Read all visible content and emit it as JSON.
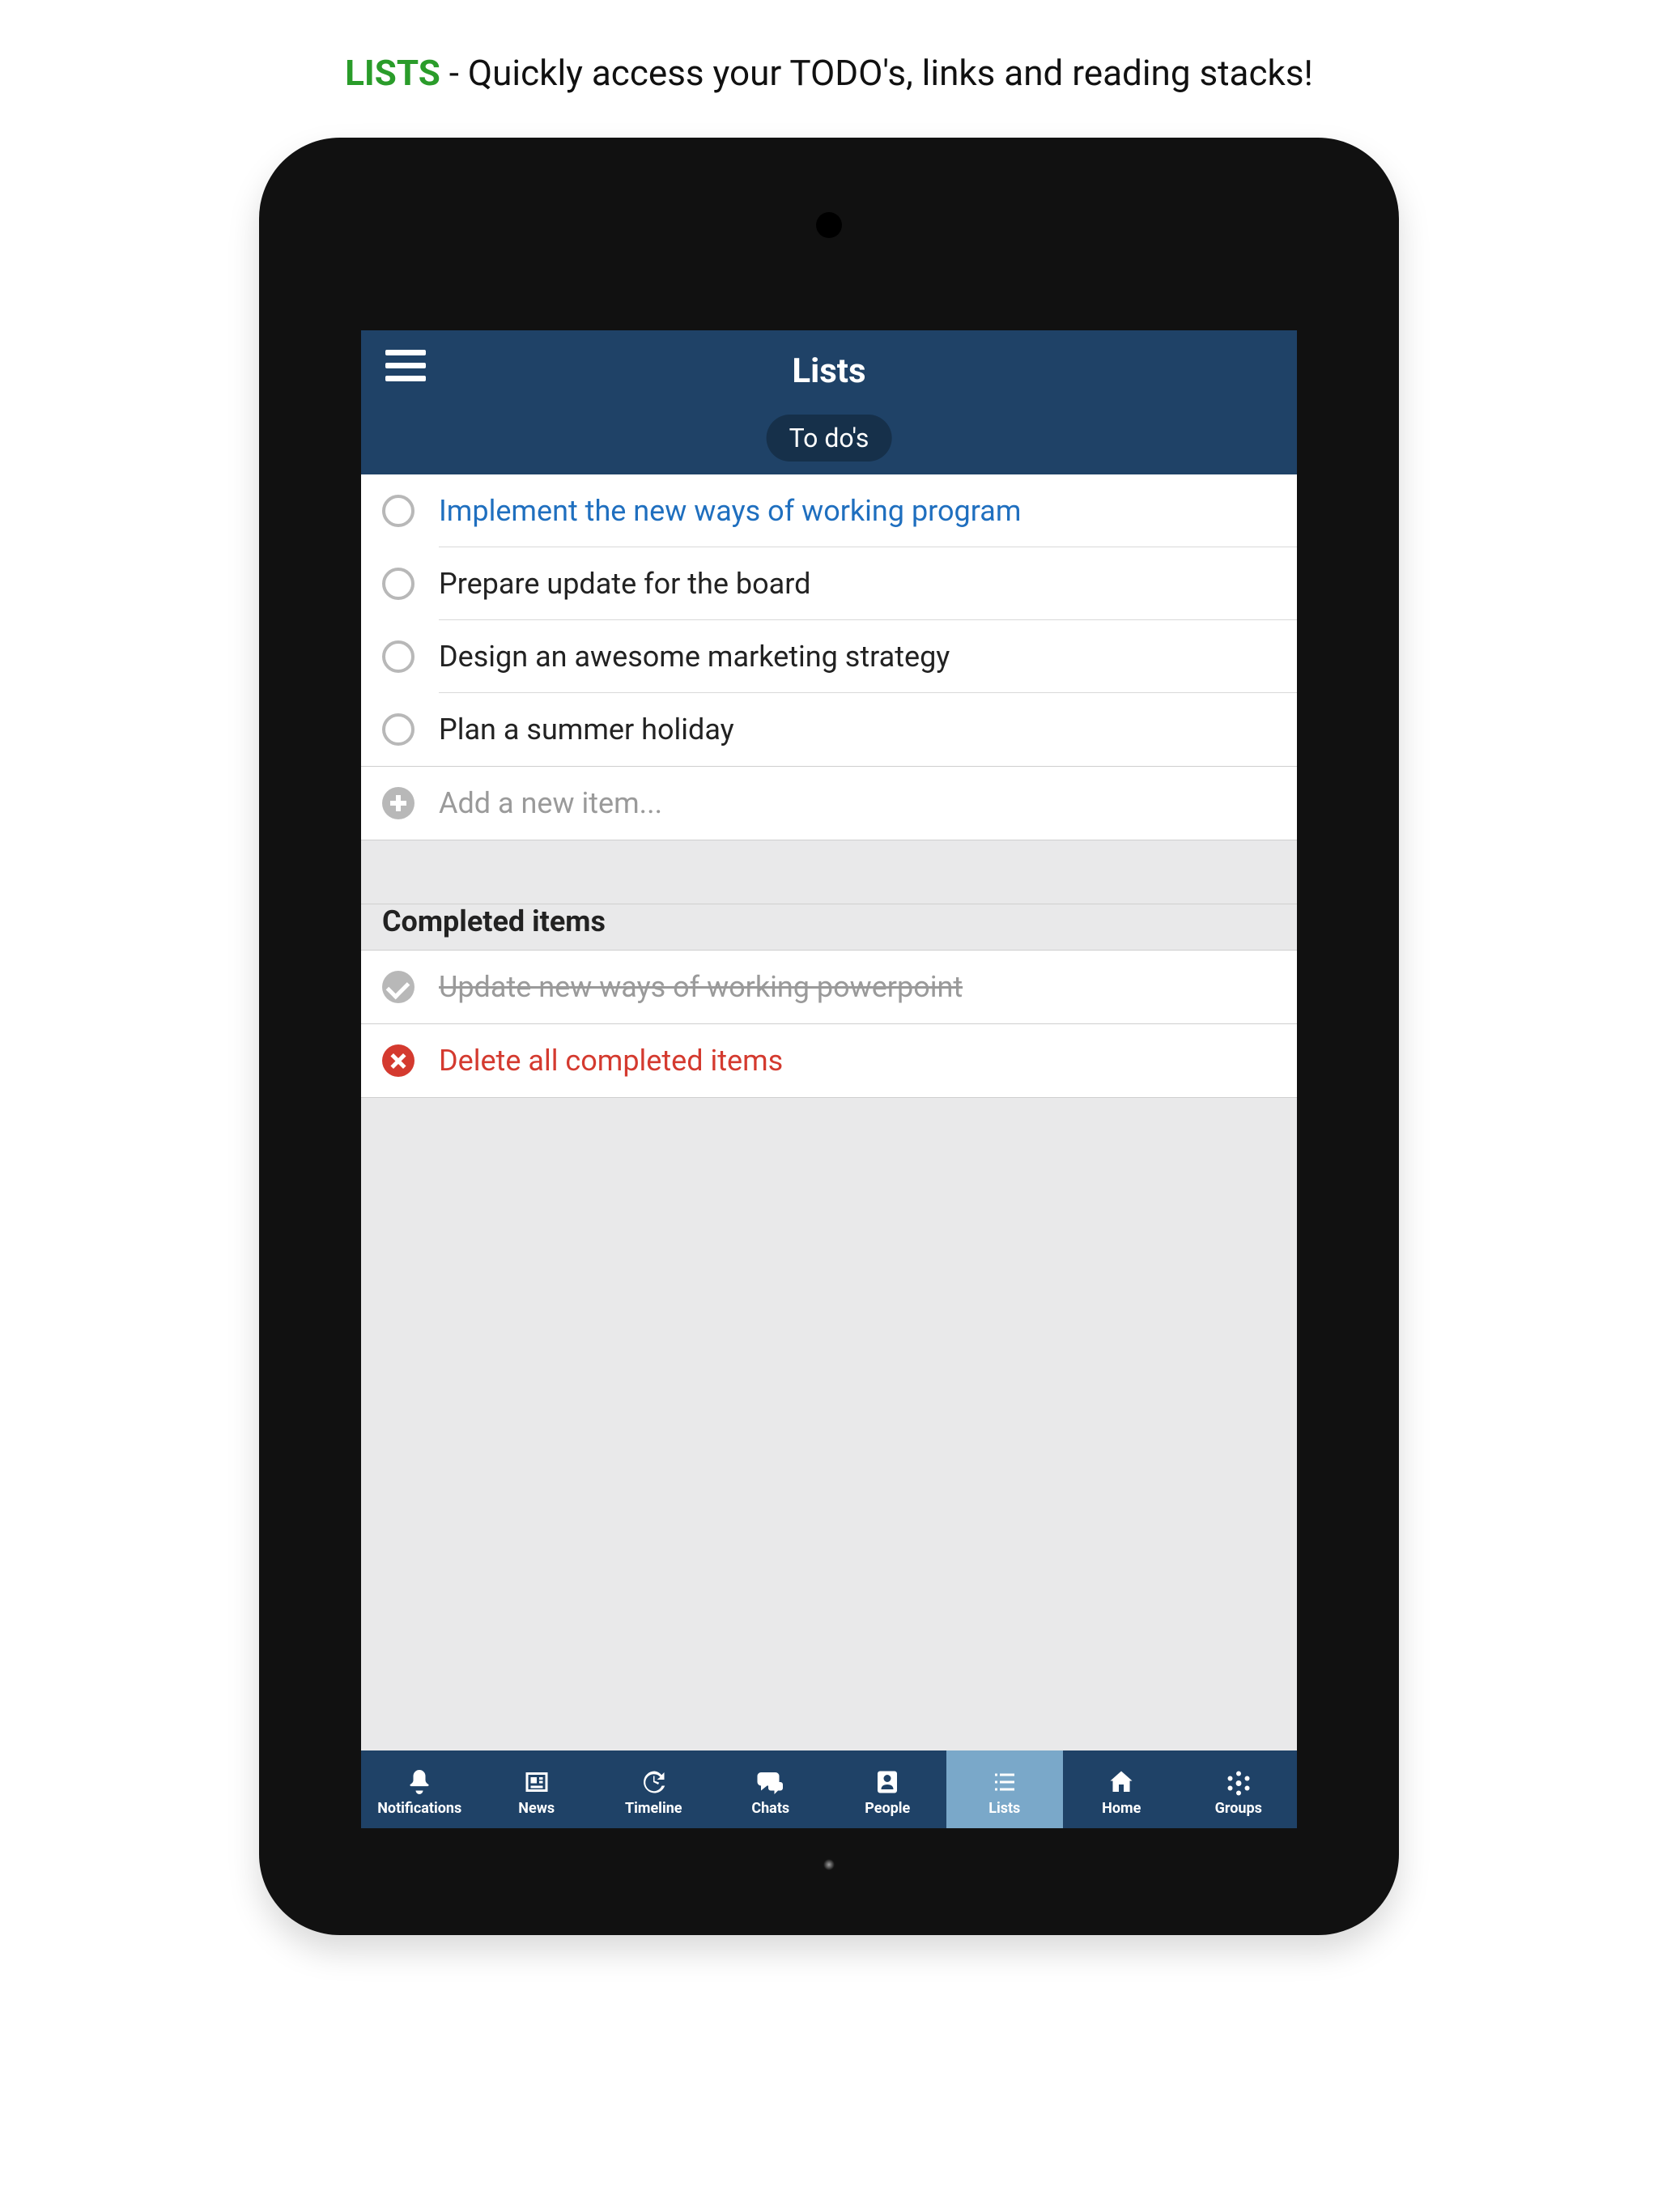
{
  "marketing": {
    "highlight": "LISTS",
    "rest": " - Quickly access your TODO's, links and reading stacks!"
  },
  "header": {
    "title": "Lists",
    "filter_pill": "To do's"
  },
  "todos": {
    "items": [
      {
        "label": "Implement the new ways of working program",
        "highlighted": true
      },
      {
        "label": "Prepare update for the board",
        "highlighted": false
      },
      {
        "label": "Design an awesome marketing strategy",
        "highlighted": false
      },
      {
        "label": "Plan a summer holiday",
        "highlighted": false
      }
    ],
    "add_placeholder": "Add a new item..."
  },
  "completed": {
    "section_label": "Completed items",
    "items": [
      {
        "label": "Update new ways of working powerpoint"
      }
    ],
    "delete_label": "Delete all completed items"
  },
  "nav": {
    "items": [
      {
        "key": "notifications",
        "label": "Notifications"
      },
      {
        "key": "news",
        "label": "News"
      },
      {
        "key": "timeline",
        "label": "Timeline"
      },
      {
        "key": "chats",
        "label": "Chats"
      },
      {
        "key": "people",
        "label": "People"
      },
      {
        "key": "lists",
        "label": "Lists"
      },
      {
        "key": "home",
        "label": "Home"
      },
      {
        "key": "groups",
        "label": "Groups"
      }
    ],
    "active": "lists"
  }
}
